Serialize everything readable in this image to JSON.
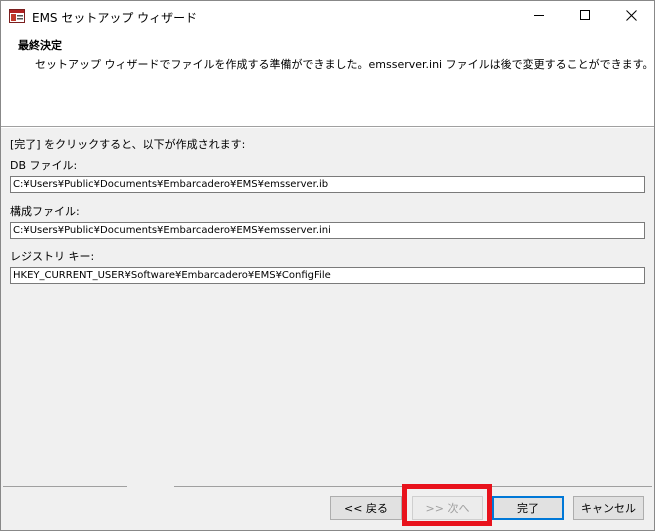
{
  "window": {
    "title": "EMS セットアップ ウィザード",
    "icon": "setup-app-icon"
  },
  "header": {
    "title": "最終決定",
    "description": "セットアップ ウィザードでファイルを作成する準備ができました。emsserver.ini ファイルは後で変更することができます。"
  },
  "content": {
    "intro": "[完了] をクリックすると、以下が作成されます:",
    "db_label": "DB ファイル:",
    "db_value": "C:¥Users¥Public¥Documents¥Embarcadero¥EMS¥emsserver.ib",
    "config_label": "構成ファイル:",
    "config_value": "C:¥Users¥Public¥Documents¥Embarcadero¥EMS¥emsserver.ini",
    "registry_label": "レジストリ キー:",
    "registry_value": "HKEY_CURRENT_USER¥Software¥Embarcadero¥EMS¥ConfigFile"
  },
  "buttons": {
    "back": "<< 戻る",
    "next": ">> 次へ",
    "finish": "完了",
    "cancel": "キャンセル"
  },
  "colors": {
    "highlight": "#e8121c",
    "default_button_border": "#0078d7"
  }
}
